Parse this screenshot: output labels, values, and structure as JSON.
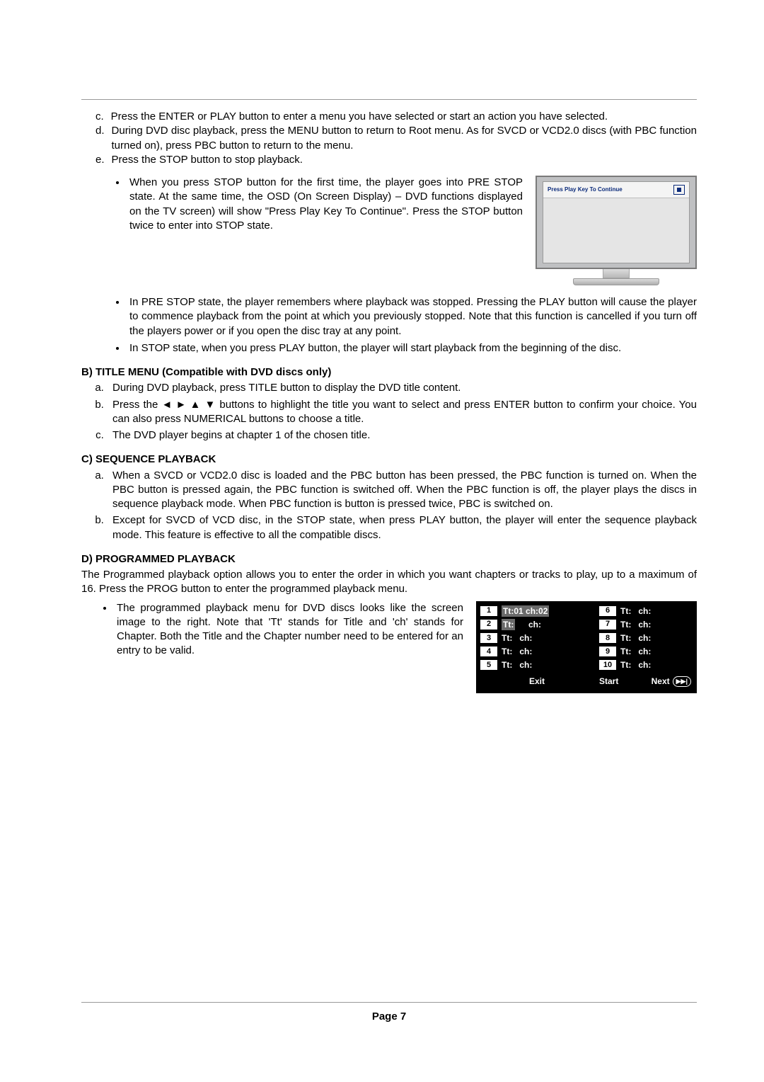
{
  "itemC": {
    "marker": "c.",
    "text": "Press the ENTER or PLAY button to enter a menu you have selected or start an action you have selected."
  },
  "itemD": {
    "marker": "d.",
    "text": "During DVD disc playback, press the MENU button to return to Root menu. As for SVCD or VCD2.0 discs (with PBC function turned on), press PBC button to return to the menu."
  },
  "itemE": {
    "marker": "e.",
    "text": "Press the STOP button to stop playback."
  },
  "eBullet1": "When you press STOP button for the first time, the player goes into PRE STOP state. At the same time, the OSD (On Screen Display) – DVD functions displayed on the TV screen) will show \"Press Play Key To Continue\". Press the STOP button twice to enter into STOP state.",
  "monitorBar": "Press Play Key To Continue",
  "eBullet2": "In PRE STOP state, the player remembers where playback was stopped. Pressing the PLAY button will cause the player to commence playback from the point at which you previously stopped. Note that this function is cancelled if you turn off the players power or if you open the disc tray at any point.",
  "eBullet3": "In STOP state, when you press PLAY button, the player will start playback from the beginning of the disc.",
  "bHead": "B)  TITLE MENU (Compatible with DVD discs only)",
  "bItems": [
    "During DVD playback, press TITLE button to display the DVD title content.",
    "Press the ◄ ► ▲ ▼ buttons to highlight the title you want to select and press ENTER button to confirm your choice. You can also press NUMERICAL buttons to choose a title.",
    "The DVD player begins at chapter 1 of the chosen title."
  ],
  "cHead": "C) SEQUENCE PLAYBACK",
  "cItems": [
    "When a SVCD or VCD2.0 disc is loaded and the PBC button has been pressed, the PBC function is turned on. When the PBC button is pressed again, the PBC function is switched off. When the PBC function is off, the player plays the discs in sequence playback mode. When PBC function is button is pressed twice, PBC is switched on.",
    "Except for SVCD of VCD disc, in the STOP state, when press PLAY button, the player will enter the sequence playback mode. This feature is effective to all the compatible discs."
  ],
  "dHead": "D) PROGRAMMED PLAYBACK",
  "dIntro": "The Programmed playback option allows you to enter the order in which you want chapters or tracks to play, up to a maximum of 16. Press the PROG button to enter the programmed playback menu.",
  "dBullet": "The programmed playback menu for DVD discs looks like the screen image to the right. Note that 'Tt' stands for Title and 'ch' stands for Chapter. Both the Title and the Chapter number need to be entered for an entry to be valid.",
  "progMenu": {
    "rows": [
      {
        "l": "1",
        "ltextA": "Tt:01",
        "ltextB": "ch:02",
        "r": "6",
        "rtextA": "Tt:",
        "rtextB": "ch:"
      },
      {
        "l": "2",
        "ltextA": "Tt:",
        "ltextB": "ch:",
        "r": "7",
        "rtextA": "Tt:",
        "rtextB": "ch:"
      },
      {
        "l": "3",
        "ltextA": "Tt:",
        "ltextB": "ch:",
        "r": "8",
        "rtextA": "Tt:",
        "rtextB": "ch:"
      },
      {
        "l": "4",
        "ltextA": "Tt:",
        "ltextB": "ch:",
        "r": "9",
        "rtextA": "Tt:",
        "rtextB": "ch:"
      },
      {
        "l": "5",
        "ltextA": "Tt:",
        "ltextB": "ch:",
        "r": "10",
        "rtextA": "Tt:",
        "rtextB": "ch:"
      }
    ],
    "exit": "Exit",
    "start": "Start",
    "next": "Next"
  },
  "pageLabel": "Page 7"
}
